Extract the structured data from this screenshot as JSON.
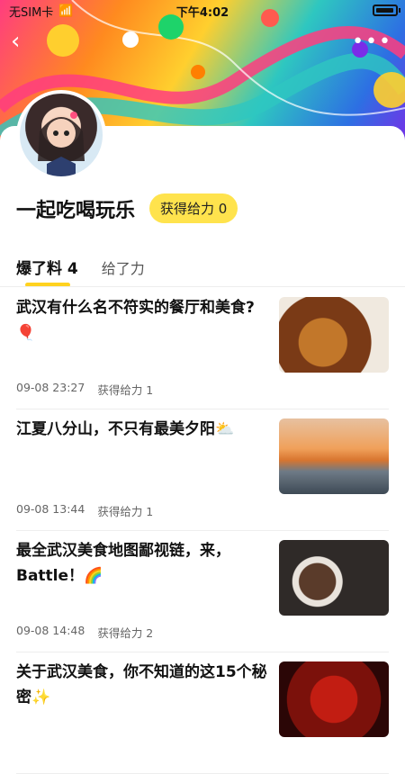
{
  "status_bar": {
    "carrier": "无SIM卡",
    "time": "下午4:02"
  },
  "profile": {
    "username": "一起吃喝玩乐",
    "power_badge": "获得给力 0"
  },
  "tabs": [
    {
      "label": "爆了料 4",
      "active": true
    },
    {
      "label": "给了力",
      "active": false
    }
  ],
  "posts": [
    {
      "title": "武汉有什么名不符实的餐厅和美食?🎈",
      "date": "09-08 23:27",
      "power": "获得给力 1",
      "thumb_icon": "noodle-photo"
    },
    {
      "title": "江夏八分山，不只有最美夕阳⛅",
      "date": "09-08 13:44",
      "power": "获得给力 1",
      "thumb_icon": "sunset-photo"
    },
    {
      "title": "最全武汉美食地图鄙视链，来，Battle！🌈",
      "date": "09-08 14:48",
      "power": "获得给力 2",
      "thumb_icon": "food-photo"
    },
    {
      "title": "关于武汉美食，你不知道的这15个秘密✨",
      "date": "",
      "power": "",
      "thumb_icon": "chili-photo"
    }
  ],
  "colors": {
    "accent": "#ffd21f",
    "badge_bg": "#ffe34d"
  }
}
